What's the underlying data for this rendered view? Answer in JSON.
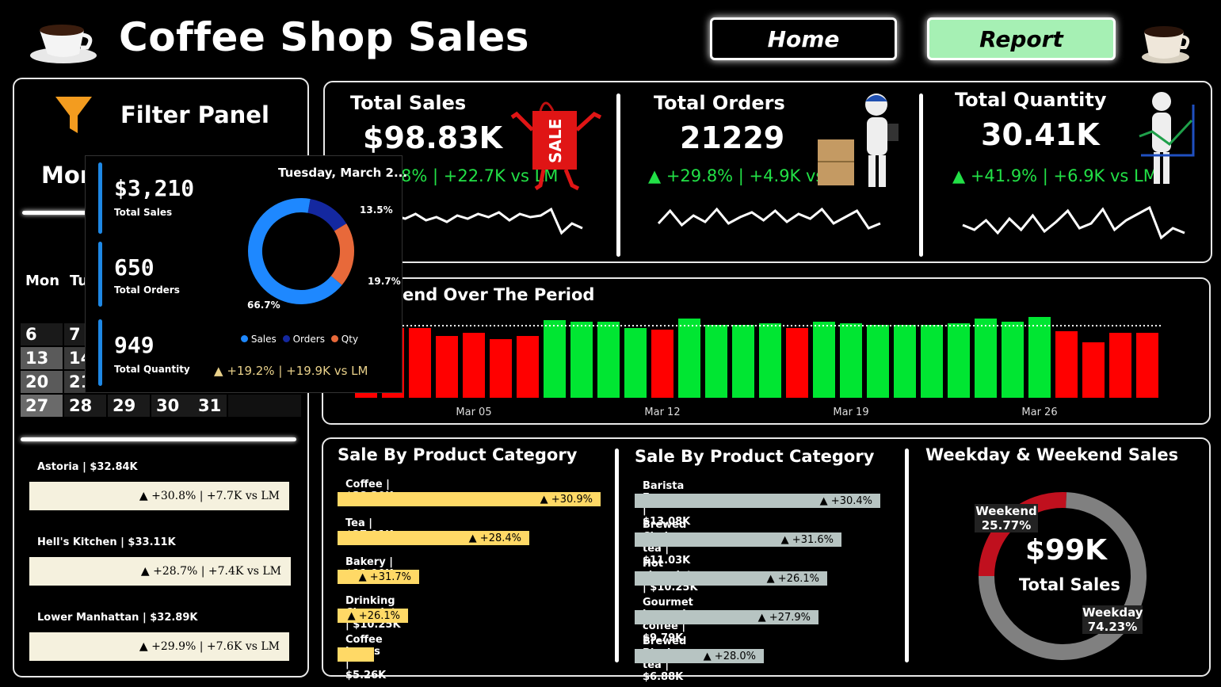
{
  "header": {
    "title": "Coffee Shop Sales",
    "home_label": "Home",
    "report_label": "Report"
  },
  "filter_panel": {
    "title": "Filter Panel",
    "month_partial": "Mon",
    "weekday_partial": [
      "Mon",
      "Tu"
    ],
    "calendar_rows": [
      [
        "6",
        "7"
      ],
      [
        "13",
        "14"
      ],
      [
        "20",
        "21"
      ],
      [
        "27",
        "28",
        "29",
        "30",
        "31"
      ]
    ]
  },
  "stores": [
    {
      "label": "Astoria | $32.84K",
      "delta": "▲ +30.8% | +7.7K vs LM"
    },
    {
      "label": "Hell's Kitchen | $33.11K",
      "delta": "▲ +28.7% | +7.4K vs LM"
    },
    {
      "label": "Lower Manhattan | $32.89K",
      "delta": "▲ +29.9% | +7.6K vs LM"
    }
  ],
  "kpis": [
    {
      "title": "Total Sales",
      "value": "$98.83K",
      "delta": "▲ +29.8% | +22.7K vs LM",
      "delta_visible": "8% | +22.7K vs LM",
      "icon": "sale-bag-icon"
    },
    {
      "title": "Total Orders",
      "value": "21229",
      "delta": "▲ +29.8% | +4.9K vs LM",
      "icon": "delivery-person-icon"
    },
    {
      "title": "Total Quantity",
      "value": "30.41K",
      "delta": "▲ +41.9% | +6.9K vs LM",
      "icon": "growth-chart-person-icon"
    }
  ],
  "trend": {
    "title_partial": "end Over The Period",
    "chart_data": {
      "type": "bar",
      "x_tick_labels": [
        "Mar 05",
        "Mar 12",
        "Mar 19",
        "Mar 26"
      ],
      "values": [
        88,
        88,
        88,
        78,
        82,
        74,
        78,
        98,
        96,
        96,
        88,
        86,
        100,
        92,
        92,
        94,
        88,
        96,
        94,
        92,
        92,
        92,
        94,
        100,
        96,
        102,
        84,
        70,
        82,
        82
      ],
      "colors": [
        "red",
        "red",
        "red",
        "red",
        "red",
        "red",
        "red",
        "green",
        "green",
        "green",
        "green",
        "red",
        "green",
        "green",
        "green",
        "green",
        "red",
        "green",
        "green",
        "green",
        "green",
        "green",
        "green",
        "green",
        "green",
        "green",
        "red",
        "red",
        "red",
        "red"
      ],
      "average_line": 91,
      "colors_legend": {
        "above_avg": "#00e632",
        "below_avg": "#ff0000"
      }
    }
  },
  "product_category": {
    "title": "Sale By Product Category",
    "items": [
      {
        "label": "Coffee | $38.30K",
        "delta": "▲ +30.9%",
        "value": 38.3
      },
      {
        "label": "Tea | $27.91K",
        "delta": "▲ +28.4%",
        "value": 27.91
      },
      {
        "label": "Bakery | $11.90K",
        "delta": "▲ +31.7%",
        "value": 11.9
      },
      {
        "label": "Drinking Chocolate | $10.25K",
        "delta": "▲ +26.1%",
        "value": 10.25
      },
      {
        "label": "Coffee beans | $5.26K",
        "delta": "",
        "value": 5.26
      }
    ]
  },
  "product_type": {
    "title": "Sale By Product Category",
    "items": [
      {
        "label": "Barista Espresso | $13.08K",
        "delta": "▲ +30.4%",
        "value": 13.08
      },
      {
        "label": "Brewed Chai tea | $11.03K",
        "delta": "▲ +31.6%",
        "value": 11.03
      },
      {
        "label": "Hot chocolate | $10.25K",
        "delta": "▲ +26.1%",
        "value": 10.25
      },
      {
        "label": "Gourmet brewed coffee | $9.79K",
        "delta": "▲ +27.9%",
        "value": 9.79
      },
      {
        "label": "Brewed Black tea | $6.88K",
        "delta": "▲ +28.0%",
        "value": 6.88
      }
    ]
  },
  "weekday_weekend": {
    "title": "Weekday & Weekend Sales",
    "center_value": "$99K",
    "center_label": "Total Sales",
    "weekend_label": "Weekend",
    "weekend_pct": "25.77%",
    "weekday_label": "Weekday",
    "weekday_pct": "74.23%",
    "chart_data": {
      "type": "pie",
      "labels": [
        "Weekend",
        "Weekday"
      ],
      "values": [
        25.77,
        74.23
      ],
      "colors": [
        "#c0101e",
        "#808080"
      ]
    }
  },
  "tooltip": {
    "date": "Tuesday, March 2...",
    "sales_value": "$3,210",
    "sales_label": "Total Sales",
    "orders_value": "650",
    "orders_label": "Total Orders",
    "qty_value": "949",
    "qty_label": "Total Quantity",
    "delta": "+19.2% | +19.9K vs LM",
    "legend": [
      "Sales",
      "Orders",
      "Qty"
    ],
    "chart_data": {
      "type": "pie",
      "labels": [
        "Sales",
        "Orders",
        "Qty"
      ],
      "values": [
        66.7,
        13.5,
        19.7
      ],
      "value_labels": [
        "66.7%",
        "13.5%",
        "19.7%"
      ],
      "colors": [
        "#1e88ff",
        "#1428a0",
        "#e8693a"
      ]
    }
  }
}
